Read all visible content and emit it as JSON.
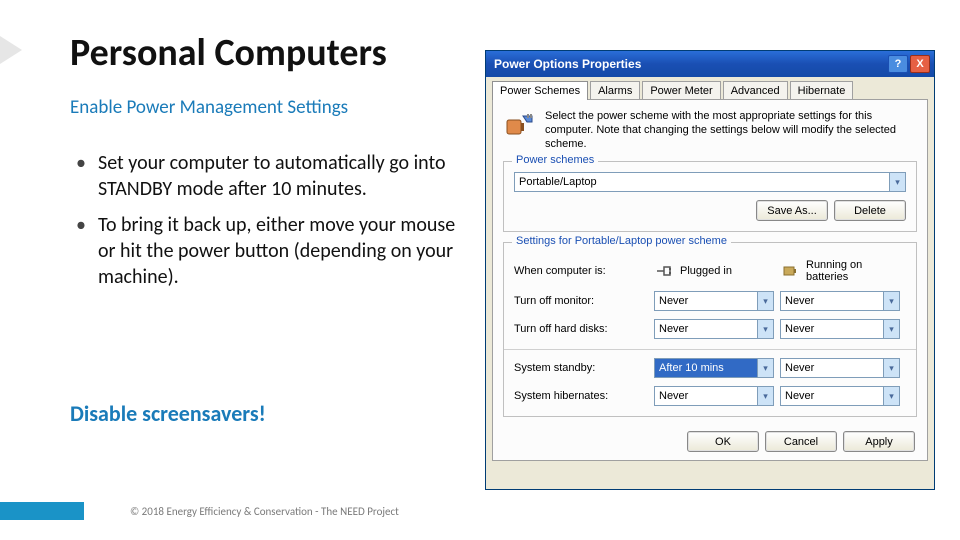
{
  "slide": {
    "title": "Personal Computers",
    "subtitle": "Enable Power Management Settings",
    "bullets": [
      "Set your computer to automatically go into STANDBY mode after 10 minutes.",
      "To bring it back up, either move your mouse or hit the power button (depending on your machine)."
    ],
    "disable": "Disable screensavers!",
    "footer": "© 2018 Energy Efficiency & Conservation - The NEED Project"
  },
  "dialog": {
    "title": "Power Options Properties",
    "help": "?",
    "close": "X",
    "tabs": [
      "Power Schemes",
      "Alarms",
      "Power Meter",
      "Advanced",
      "Hibernate"
    ],
    "intro": "Select the power scheme with the most appropriate settings for this computer. Note that changing the settings below will modify the selected scheme.",
    "group_schemes": "Power schemes",
    "scheme_value": "Portable/Laptop",
    "save_as": "Save As...",
    "delete": "Delete",
    "group_settings": "Settings for Portable/Laptop power scheme",
    "col_when": "When computer is:",
    "col_plugged": "Plugged in",
    "col_battery": "Running on batteries",
    "rows": {
      "monitor": {
        "label": "Turn off monitor:",
        "a": "Never",
        "b": "Never"
      },
      "disks": {
        "label": "Turn off hard disks:",
        "a": "Never",
        "b": "Never"
      },
      "standby": {
        "label": "System standby:",
        "a": "After 10 mins",
        "b": "Never"
      },
      "hibernate": {
        "label": "System hibernates:",
        "a": "Never",
        "b": "Never"
      }
    },
    "ok": "OK",
    "cancel": "Cancel",
    "apply": "Apply"
  }
}
